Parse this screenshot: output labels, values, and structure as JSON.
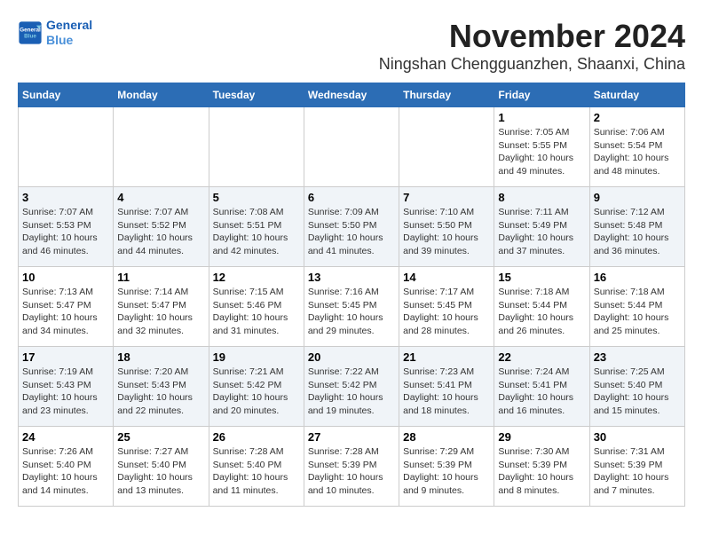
{
  "header": {
    "logo_line1": "General",
    "logo_line2": "Blue",
    "month": "November 2024",
    "location": "Ningshan Chengguanzhen, Shaanxi, China"
  },
  "weekdays": [
    "Sunday",
    "Monday",
    "Tuesday",
    "Wednesday",
    "Thursday",
    "Friday",
    "Saturday"
  ],
  "weeks": [
    [
      {
        "day": "",
        "info": ""
      },
      {
        "day": "",
        "info": ""
      },
      {
        "day": "",
        "info": ""
      },
      {
        "day": "",
        "info": ""
      },
      {
        "day": "",
        "info": ""
      },
      {
        "day": "1",
        "info": "Sunrise: 7:05 AM\nSunset: 5:55 PM\nDaylight: 10 hours\nand 49 minutes."
      },
      {
        "day": "2",
        "info": "Sunrise: 7:06 AM\nSunset: 5:54 PM\nDaylight: 10 hours\nand 48 minutes."
      }
    ],
    [
      {
        "day": "3",
        "info": "Sunrise: 7:07 AM\nSunset: 5:53 PM\nDaylight: 10 hours\nand 46 minutes."
      },
      {
        "day": "4",
        "info": "Sunrise: 7:07 AM\nSunset: 5:52 PM\nDaylight: 10 hours\nand 44 minutes."
      },
      {
        "day": "5",
        "info": "Sunrise: 7:08 AM\nSunset: 5:51 PM\nDaylight: 10 hours\nand 42 minutes."
      },
      {
        "day": "6",
        "info": "Sunrise: 7:09 AM\nSunset: 5:50 PM\nDaylight: 10 hours\nand 41 minutes."
      },
      {
        "day": "7",
        "info": "Sunrise: 7:10 AM\nSunset: 5:50 PM\nDaylight: 10 hours\nand 39 minutes."
      },
      {
        "day": "8",
        "info": "Sunrise: 7:11 AM\nSunset: 5:49 PM\nDaylight: 10 hours\nand 37 minutes."
      },
      {
        "day": "9",
        "info": "Sunrise: 7:12 AM\nSunset: 5:48 PM\nDaylight: 10 hours\nand 36 minutes."
      }
    ],
    [
      {
        "day": "10",
        "info": "Sunrise: 7:13 AM\nSunset: 5:47 PM\nDaylight: 10 hours\nand 34 minutes."
      },
      {
        "day": "11",
        "info": "Sunrise: 7:14 AM\nSunset: 5:47 PM\nDaylight: 10 hours\nand 32 minutes."
      },
      {
        "day": "12",
        "info": "Sunrise: 7:15 AM\nSunset: 5:46 PM\nDaylight: 10 hours\nand 31 minutes."
      },
      {
        "day": "13",
        "info": "Sunrise: 7:16 AM\nSunset: 5:45 PM\nDaylight: 10 hours\nand 29 minutes."
      },
      {
        "day": "14",
        "info": "Sunrise: 7:17 AM\nSunset: 5:45 PM\nDaylight: 10 hours\nand 28 minutes."
      },
      {
        "day": "15",
        "info": "Sunrise: 7:18 AM\nSunset: 5:44 PM\nDaylight: 10 hours\nand 26 minutes."
      },
      {
        "day": "16",
        "info": "Sunrise: 7:18 AM\nSunset: 5:44 PM\nDaylight: 10 hours\nand 25 minutes."
      }
    ],
    [
      {
        "day": "17",
        "info": "Sunrise: 7:19 AM\nSunset: 5:43 PM\nDaylight: 10 hours\nand 23 minutes."
      },
      {
        "day": "18",
        "info": "Sunrise: 7:20 AM\nSunset: 5:43 PM\nDaylight: 10 hours\nand 22 minutes."
      },
      {
        "day": "19",
        "info": "Sunrise: 7:21 AM\nSunset: 5:42 PM\nDaylight: 10 hours\nand 20 minutes."
      },
      {
        "day": "20",
        "info": "Sunrise: 7:22 AM\nSunset: 5:42 PM\nDaylight: 10 hours\nand 19 minutes."
      },
      {
        "day": "21",
        "info": "Sunrise: 7:23 AM\nSunset: 5:41 PM\nDaylight: 10 hours\nand 18 minutes."
      },
      {
        "day": "22",
        "info": "Sunrise: 7:24 AM\nSunset: 5:41 PM\nDaylight: 10 hours\nand 16 minutes."
      },
      {
        "day": "23",
        "info": "Sunrise: 7:25 AM\nSunset: 5:40 PM\nDaylight: 10 hours\nand 15 minutes."
      }
    ],
    [
      {
        "day": "24",
        "info": "Sunrise: 7:26 AM\nSunset: 5:40 PM\nDaylight: 10 hours\nand 14 minutes."
      },
      {
        "day": "25",
        "info": "Sunrise: 7:27 AM\nSunset: 5:40 PM\nDaylight: 10 hours\nand 13 minutes."
      },
      {
        "day": "26",
        "info": "Sunrise: 7:28 AM\nSunset: 5:40 PM\nDaylight: 10 hours\nand 11 minutes."
      },
      {
        "day": "27",
        "info": "Sunrise: 7:28 AM\nSunset: 5:39 PM\nDaylight: 10 hours\nand 10 minutes."
      },
      {
        "day": "28",
        "info": "Sunrise: 7:29 AM\nSunset: 5:39 PM\nDaylight: 10 hours\nand 9 minutes."
      },
      {
        "day": "29",
        "info": "Sunrise: 7:30 AM\nSunset: 5:39 PM\nDaylight: 10 hours\nand 8 minutes."
      },
      {
        "day": "30",
        "info": "Sunrise: 7:31 AM\nSunset: 5:39 PM\nDaylight: 10 hours\nand 7 minutes."
      }
    ]
  ]
}
